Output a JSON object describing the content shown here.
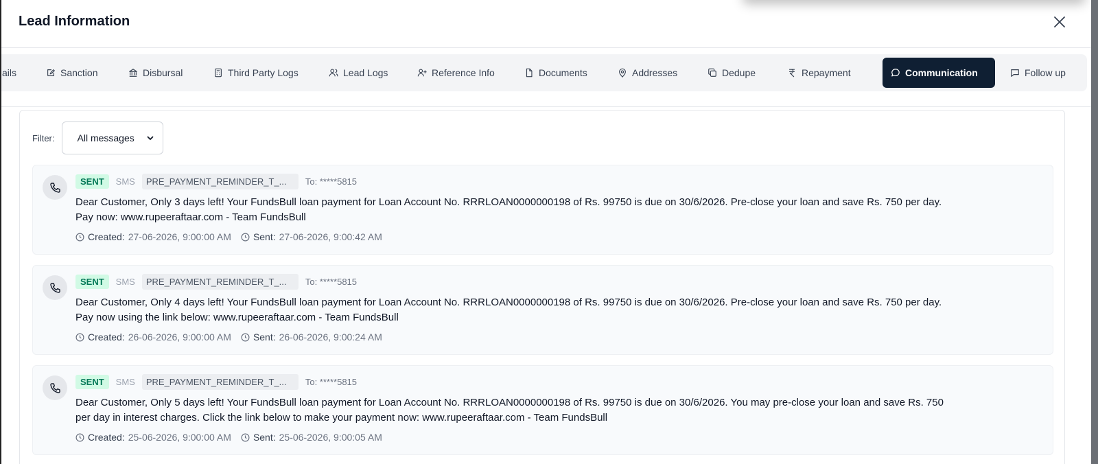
{
  "dialog": {
    "title": "Lead Information"
  },
  "tabs": [
    {
      "label": "ails",
      "icon": "details-icon"
    },
    {
      "label": "Sanction",
      "icon": "sanction-icon"
    },
    {
      "label": "Disbursal",
      "icon": "bank-icon"
    },
    {
      "label": "Third Party Logs",
      "icon": "calculator-icon"
    },
    {
      "label": "Lead Logs",
      "icon": "users-icon"
    },
    {
      "label": "Reference Info",
      "icon": "user-plus-icon"
    },
    {
      "label": "Documents",
      "icon": "file-icon"
    },
    {
      "label": "Addresses",
      "icon": "map-pin-icon"
    },
    {
      "label": "Dedupe",
      "icon": "copy-icon"
    },
    {
      "label": "Repayment",
      "icon": "rupee-icon"
    },
    {
      "label": "Communication",
      "icon": "chat-bubble-icon",
      "active": true
    },
    {
      "label": "Follow up",
      "icon": "message-square-icon"
    }
  ],
  "filter": {
    "label": "Filter:",
    "selected": "All messages"
  },
  "messages": [
    {
      "status": "SENT",
      "channel": "SMS",
      "template": "PRE_PAYMENT_REMINDER_T_...",
      "to": "To: *****5815",
      "body_line1": "Dear Customer, Only 3 days left! Your FundsBull loan payment for Loan Account No. RRRLOAN0000000198 of Rs. 99750 is due on 30/6/2026. Pre-close your loan and save Rs. 750 per day.",
      "body_line2": "Pay now: www.rupeeraftaar.com - Team FundsBull",
      "created_label": "Created:",
      "created": "27-06-2026, 9:00:00 AM",
      "sent_label": "Sent:",
      "sent": "27-06-2026, 9:00:42 AM"
    },
    {
      "status": "SENT",
      "channel": "SMS",
      "template": "PRE_PAYMENT_REMINDER_T_...",
      "to": "To: *****5815",
      "body_line1": "Dear Customer, Only 4 days left! Your FundsBull loan payment for Loan Account No. RRRLOAN0000000198 of Rs. 99750 is due on 30/6/2026. Pre-close your loan and save Rs. 750 per day.",
      "body_line2": "Pay now using the link below: www.rupeeraftaar.com - Team FundsBull",
      "created_label": "Created:",
      "created": "26-06-2026, 9:00:00 AM",
      "sent_label": "Sent:",
      "sent": "26-06-2026, 9:00:24 AM"
    },
    {
      "status": "SENT",
      "channel": "SMS",
      "template": "PRE_PAYMENT_REMINDER_T_...",
      "to": "To: *****5815",
      "body_line1": "Dear Customer, Only 5 days left! Your FundsBull loan payment for Loan Account No. RRRLOAN0000000198 of Rs. 99750 is due on 30/6/2026. You may pre-close your loan and save Rs. 750",
      "body_line2": "per day in interest charges. Click the link below to make your payment now: www.rupeeraftaar.com - Team FundsBull",
      "created_label": "Created:",
      "created": "25-06-2026, 9:00:00 AM",
      "sent_label": "Sent:",
      "sent": "25-06-2026, 9:00:05 AM"
    }
  ],
  "colors": {
    "active_tab_bg": "#0f1f33",
    "sent_badge_bg": "#d1fae5",
    "sent_badge_text": "#047857"
  }
}
